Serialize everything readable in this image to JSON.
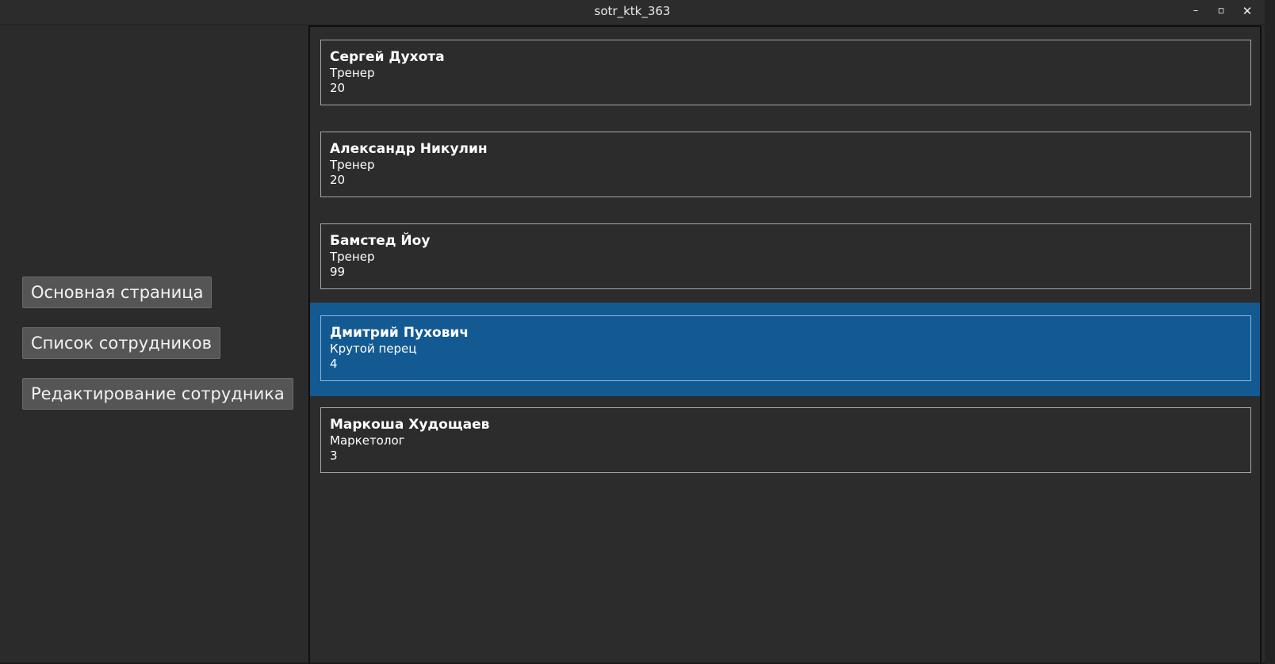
{
  "window": {
    "title": "sotr_ktk_363",
    "minimize_glyph": "–",
    "maximize_glyph": "▫",
    "close_glyph": "✕"
  },
  "nav": {
    "main_page": "Основная страница",
    "employee_list": "Список сотрудников",
    "edit_employee": "Редактирование сотрудника"
  },
  "employees": [
    {
      "name": "Сергей Духота",
      "role": "Тренер",
      "value": "20"
    },
    {
      "name": "Александр Никулин",
      "role": "Тренер",
      "value": "20"
    },
    {
      "name": "Бамстед Йоу",
      "role": "Тренер",
      "value": "99"
    },
    {
      "name": "Дмитрий Пухович",
      "role": "Крутой перец",
      "value": "4"
    },
    {
      "name": "Маркоша Худощаев",
      "role": "Маркетолог",
      "value": "3"
    }
  ],
  "selected_index": 3,
  "colors": {
    "background": "#2b2b2b",
    "selection": "#135a93",
    "button": "#555555",
    "text": "#ffffff"
  }
}
